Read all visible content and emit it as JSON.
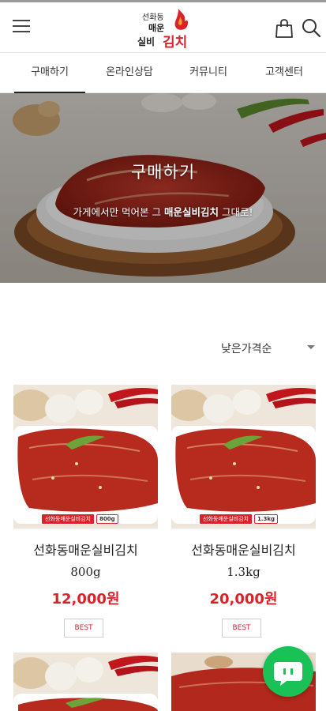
{
  "header": {
    "logo_alt": "선화동 매운 실비김치",
    "menu_icon": "hamburger-menu-icon",
    "cart_icon": "shopping-bag-icon",
    "search_icon": "search-icon"
  },
  "tabs": [
    {
      "label": "구매하기",
      "active": true
    },
    {
      "label": "온라인상담",
      "active": false
    },
    {
      "label": "커뮤니티",
      "active": false
    },
    {
      "label": "고객센터",
      "active": false
    }
  ],
  "hero": {
    "title": "구매하기",
    "subtitle_prefix": "가게에서만 먹어본 그 ",
    "subtitle_bold": "매운실비김치",
    "subtitle_suffix": " 그대로!"
  },
  "sort": {
    "selected": "낮은가격순"
  },
  "products": [
    {
      "name": "선화동매운실비김치",
      "weight": "800g",
      "price": "12,000원",
      "badge": "BEST",
      "tag_brand": "선화동매운실비김치",
      "tag_weight": "800g"
    },
    {
      "name": "선화동매운실비김치",
      "weight": "1.3kg",
      "price": "20,000원",
      "badge": "BEST",
      "tag_brand": "선화동매운실비김치",
      "tag_weight": "1.3kg"
    }
  ],
  "chat": {
    "icon": "chat-bubble-icon"
  },
  "colors": {
    "accent": "#d8232a",
    "chat": "#19c157"
  }
}
